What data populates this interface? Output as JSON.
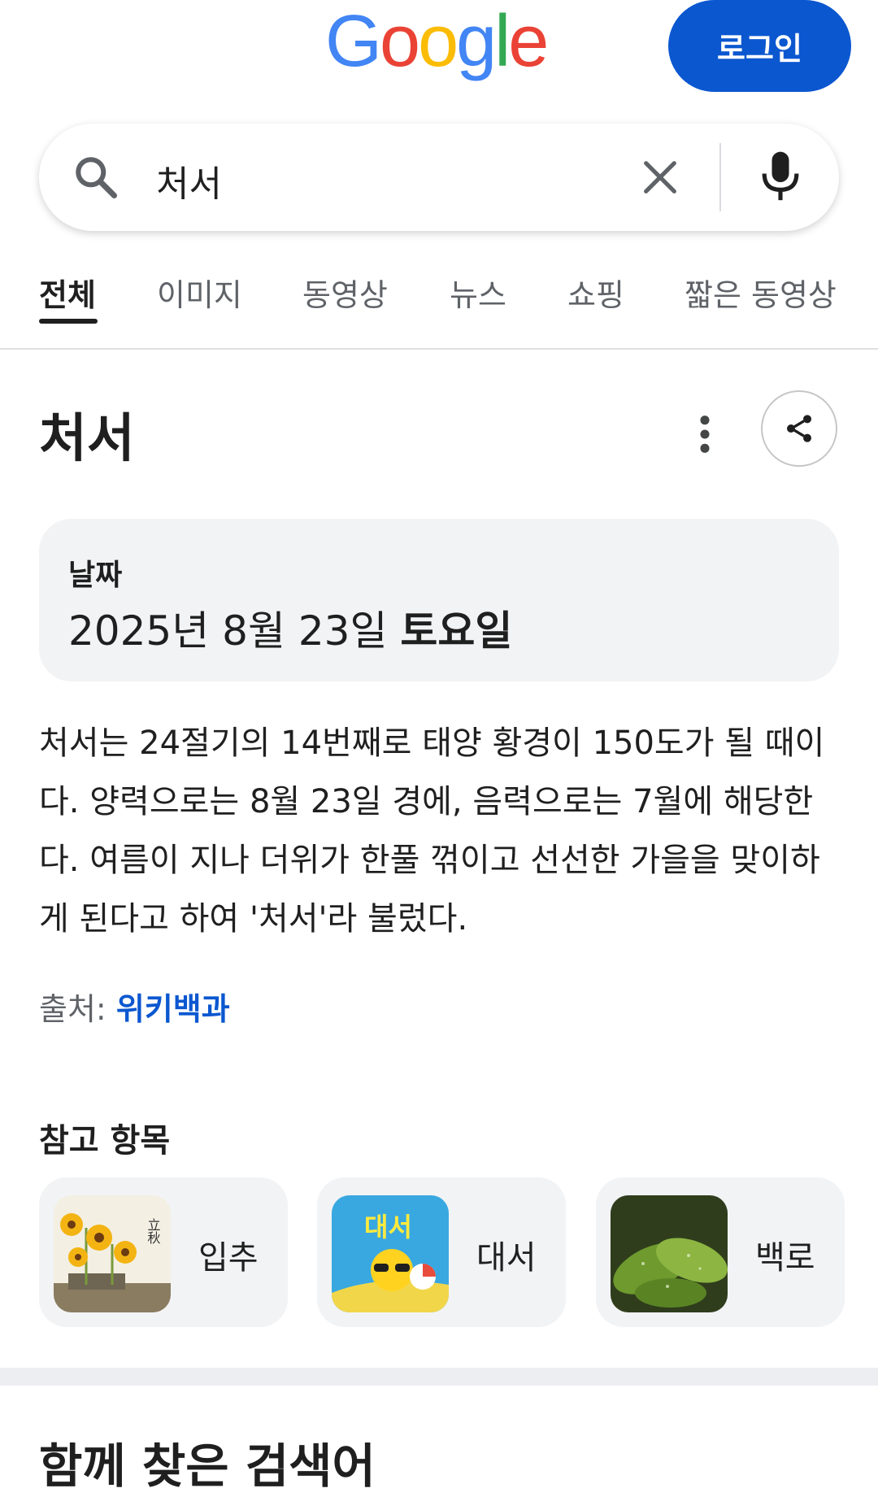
{
  "header": {
    "logo_letters": [
      "G",
      "o",
      "o",
      "g",
      "l",
      "e"
    ],
    "logo_colors": [
      "#4285F4",
      "#EA4335",
      "#FBBC05",
      "#4285F4",
      "#34A853",
      "#EA4335"
    ],
    "login_label": "로그인"
  },
  "search": {
    "query": "처서",
    "icons": [
      "search-icon",
      "clear-icon",
      "mic-icon"
    ]
  },
  "tabs": [
    {
      "label": "전체",
      "active": true
    },
    {
      "label": "이미지",
      "active": false
    },
    {
      "label": "동영상",
      "active": false
    },
    {
      "label": "뉴스",
      "active": false
    },
    {
      "label": "쇼핑",
      "active": false
    },
    {
      "label": "짧은 동영상",
      "active": false
    }
  ],
  "knowledge_panel": {
    "title": "처서",
    "date": {
      "label": "날짜",
      "value_main": "2025년 8월 23일",
      "value_weekday": "토요일"
    },
    "description": "처서는 24절기의 14번째로 태양 황경이 150도가 될 때이다. 양력으로는 8월 23일 경에, 음력으로는 7월에 해당한다. 여름이 지나 더위가 한풀 꺾이고 선선한 가을을 맞이하게 된다고 하여 '처서'라 불렀다.",
    "source_prefix": "출처:",
    "source_link": "위키백과"
  },
  "see_also": {
    "title": "참고 항목",
    "items": [
      {
        "label": "입추",
        "thumb_text": "立秋"
      },
      {
        "label": "대서",
        "thumb_text": "대서"
      },
      {
        "label": "백로",
        "thumb_text": ""
      }
    ]
  },
  "related_searches": {
    "title": "함께 찾은 검색어"
  },
  "colors": {
    "accent": "#0b57d0",
    "card_bg": "#f2f3f5",
    "muted_text": "#5f6368"
  }
}
